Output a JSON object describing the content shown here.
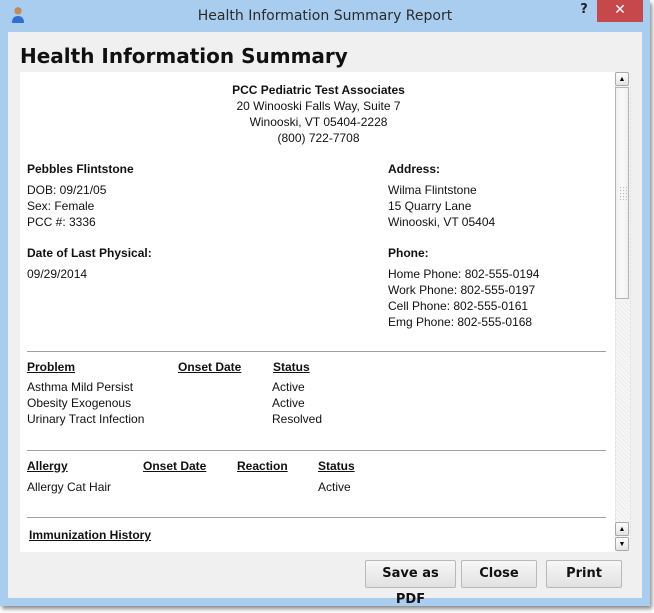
{
  "window": {
    "title": "Health Information Summary Report",
    "help_label": "?",
    "close_label": "✕",
    "app_icon": "user-icon"
  },
  "heading": "Health Information Summary",
  "practice": {
    "name": "PCC Pediatric Test Associates",
    "address1": "20 Winooski Falls Way, Suite 7",
    "address2": "Winooski, VT 05404-2228",
    "phone": "(800) 722-7708"
  },
  "patient": {
    "name": "Pebbles Flintstone",
    "dob": "DOB: 09/21/05",
    "sex": "Sex: Female",
    "pcc": "PCC #: 3336",
    "last_physical_label": "Date of Last Physical:",
    "last_physical": "09/29/2014"
  },
  "address": {
    "label": "Address:",
    "line1": "Wilma Flintstone",
    "line2": "15 Quarry Lane",
    "line3": "Winooski, VT 05404"
  },
  "phone": {
    "label": "Phone:",
    "home": "Home Phone: 802-555-0194",
    "work": "Work Phone: 802-555-0197",
    "cell": "Cell Phone: 802-555-0161",
    "emg": "Emg Phone: 802-555-0168"
  },
  "problems": {
    "headers": [
      "Problem",
      "Onset Date",
      "Status"
    ],
    "rows": [
      {
        "problem": "Asthma Mild Persist",
        "onset": "",
        "status": "Active"
      },
      {
        "problem": "Obesity Exogenous",
        "onset": "",
        "status": "Active"
      },
      {
        "problem": "Urinary Tract Infection",
        "onset": "",
        "status": "Resolved"
      }
    ]
  },
  "allergies": {
    "headers": [
      "Allergy",
      "Onset Date",
      "Reaction",
      "Status"
    ],
    "rows": [
      {
        "allergy": "Allergy Cat Hair",
        "onset": "",
        "reaction": "",
        "status": "Active"
      }
    ]
  },
  "immunization": {
    "heading": "Immunization History"
  },
  "scrollbar": {
    "up_label": "▲",
    "down_label": "▼"
  },
  "buttons": {
    "save_pdf": "Save as PDF",
    "close": "Close",
    "print": "Print"
  }
}
